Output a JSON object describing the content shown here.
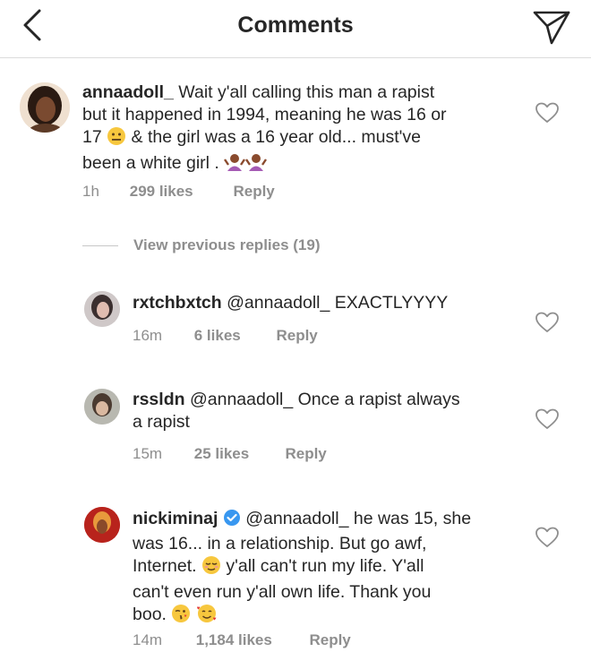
{
  "header": {
    "title": "Comments"
  },
  "main_comment": {
    "username": "annaadoll_",
    "text_line1": " Wait y'all calling this man a rapist",
    "text_line2": "but it happened in 1994, meaning he was 16 or",
    "text_line3a": "17 ",
    "text_line3b": " & the girl was a 16 year old... must've",
    "text_line4": "been a white girl . ",
    "time": "1h",
    "likes": "299 likes",
    "reply": "Reply"
  },
  "view_previous": {
    "label": "View previous replies (19)"
  },
  "replies": [
    {
      "username": "rxtchbxtch",
      "mention": "@annaadoll_",
      "text": " EXACTLYYYY",
      "time": "16m",
      "likes": "6 likes",
      "reply": "Reply"
    },
    {
      "username": "rssldn",
      "mention": "@annaadoll_",
      "text_line1": " Once a rapist always",
      "text_line2": "a rapist",
      "time": "15m",
      "likes": "25 likes",
      "reply": "Reply"
    },
    {
      "username": "nickiminaj",
      "mention": "@annaadoll_",
      "text_line1": " he was 15, she",
      "text_line2": "was 16... in a relationship. But go awf,",
      "text_line3a": "Internet. ",
      "text_line3b": " y'all can't run my life. Y'all",
      "text_line4": "can't even run y'all own life. Thank you",
      "text_line5": "boo. ",
      "time": "14m",
      "likes": "1,184 likes",
      "reply": "Reply"
    }
  ],
  "icons": {
    "back": "chevron-left-icon",
    "share": "paper-plane-icon",
    "like": "heart-outline-icon",
    "verified": "verified-badge-icon"
  },
  "colors": {
    "text": "#262626",
    "secondary": "#8e8e8e",
    "verified": "#3897f0"
  }
}
